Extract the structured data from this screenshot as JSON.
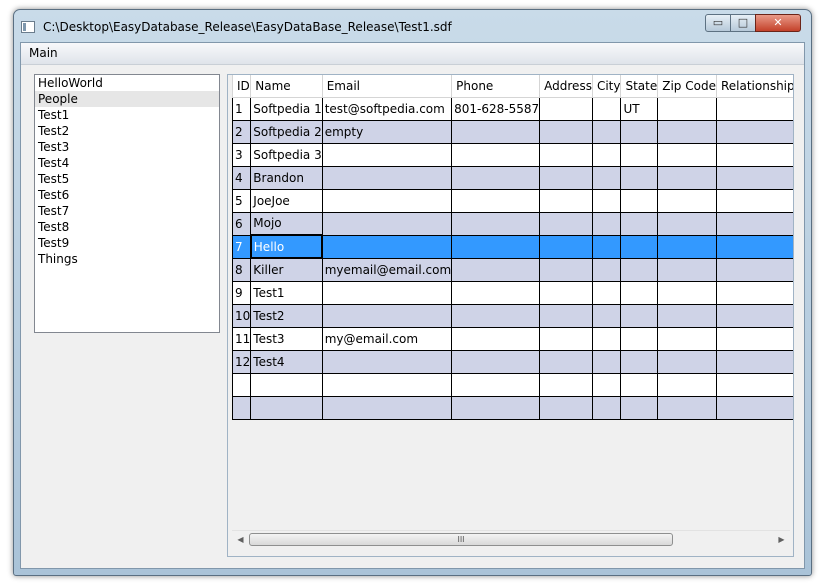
{
  "window": {
    "title": "C:\\Desktop\\EasyDatabase_Release\\EasyDataBase_Release\\Test1.sdf",
    "minimize_label": "▭",
    "maximize_label": "□",
    "close_label": "✕"
  },
  "menu": {
    "main_label": "Main"
  },
  "tables_list": [
    "HelloWorld",
    "People",
    "Test1",
    "Test2",
    "Test3",
    "Test4",
    "Test5",
    "Test6",
    "Test7",
    "Test8",
    "Test9",
    "Things"
  ],
  "selected_table": "People",
  "grid": {
    "columns": [
      "ID",
      "Name",
      "Email",
      "Phone",
      "Address",
      "City",
      "State",
      "Zip Code",
      "Relationship"
    ],
    "rows": [
      [
        "1",
        "Softpedia 1",
        "test@softpedia.com",
        "801-628-5587",
        "",
        "",
        "UT",
        "",
        ""
      ],
      [
        "2",
        "Softpedia 2",
        "empty",
        "",
        "",
        "",
        "",
        "",
        ""
      ],
      [
        "3",
        "Softpedia 3",
        "",
        "",
        "",
        "",
        "",
        "",
        ""
      ],
      [
        "4",
        "Brandon",
        "",
        "",
        "",
        "",
        "",
        "",
        ""
      ],
      [
        "5",
        "JoeJoe",
        "",
        "",
        "",
        "",
        "",
        "",
        ""
      ],
      [
        "6",
        "Mojo",
        "",
        "",
        "",
        "",
        "",
        "",
        ""
      ],
      [
        "7",
        "Hello",
        "",
        "",
        "",
        "",
        "",
        "",
        ""
      ],
      [
        "8",
        "Killer",
        "myemail@email.com",
        "",
        "",
        "",
        "",
        "",
        ""
      ],
      [
        "9",
        "Test1",
        "",
        "",
        "",
        "",
        "",
        "",
        ""
      ],
      [
        "10",
        "Test2",
        "",
        "",
        "",
        "",
        "",
        "",
        ""
      ],
      [
        "11",
        "Test3",
        "my@email.com",
        "",
        "",
        "",
        "",
        "",
        ""
      ],
      [
        "12",
        "Test4",
        "",
        "",
        "",
        "",
        "",
        "",
        ""
      ],
      [
        "",
        "",
        "",
        "",
        "",
        "",
        "",
        "",
        ""
      ],
      [
        "",
        "",
        "",
        "",
        "",
        "",
        "",
        "",
        ""
      ]
    ],
    "selected_row_index": 6
  },
  "scrollbar": {
    "left_arrow": "◀",
    "right_arrow": "▶",
    "grip": "III"
  }
}
